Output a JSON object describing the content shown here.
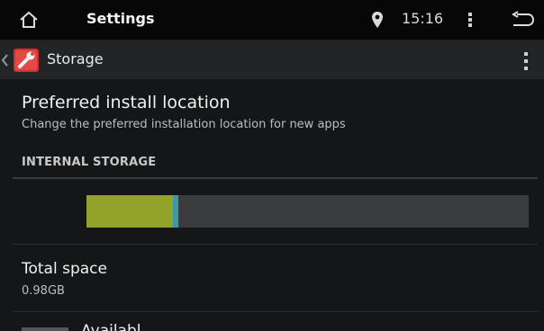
{
  "statusbar": {
    "title": "Settings",
    "time": "15:16",
    "icons": [
      "home-icon",
      "location-pin-icon",
      "overflow-menu-icon",
      "back-icon"
    ]
  },
  "actionbar": {
    "title": "Storage",
    "icons": [
      "settings-app-icon",
      "overflow-menu-icon"
    ]
  },
  "preferred_install": {
    "title": "Preferred install location",
    "subtitle": "Change the preferred installation location for new apps"
  },
  "internal_storage": {
    "header": "INTERNAL STORAGE",
    "usage_bar": {
      "used_fraction": 0.195,
      "secondary_fraction": 0.012,
      "colors": {
        "used": "#93a22a",
        "secondary": "#3b9aa5",
        "free": "#3b3c3e"
      }
    }
  },
  "total_space": {
    "title": "Total space",
    "value": "0.98GB"
  },
  "next_item": {
    "title": "Availabl"
  },
  "colors": {
    "background": "#151617",
    "statusbar": "#070707",
    "actionbar": "#232425",
    "app_icon": "#d32f2f"
  }
}
